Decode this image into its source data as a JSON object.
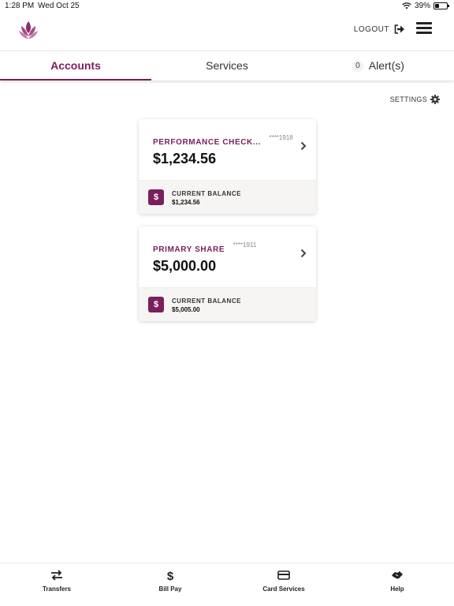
{
  "status": {
    "time": "1:28 PM",
    "date": "Wed Oct 25",
    "battery": "39%",
    "battery_level": 0.39
  },
  "header": {
    "logout_label": "LOGOUT"
  },
  "tabs": [
    {
      "label": "Accounts",
      "active": true
    },
    {
      "label": "Services",
      "active": false
    },
    {
      "label": "Alert(s)",
      "count": "0",
      "active": false
    }
  ],
  "settings_label": "SETTINGS",
  "accounts": [
    {
      "name": "PERFORMANCE CHECK...",
      "number": "****1918",
      "amount": "$1,234.56",
      "balance_label": "CURRENT BALANCE",
      "balance_value": "$1,234.56"
    },
    {
      "name": "PRIMARY SHARE",
      "number": "****1911",
      "amount": "$5,000.00",
      "balance_label": "CURRENT BALANCE",
      "balance_value": "$5,005.00"
    }
  ],
  "bottom_nav": [
    {
      "label": "Transfers",
      "icon": "transfer-arrows-icon"
    },
    {
      "label": "Bill Pay",
      "icon": "dollar-icon"
    },
    {
      "label": "Card Services",
      "icon": "credit-card-icon"
    },
    {
      "label": "Help",
      "icon": "handshake-icon"
    }
  ],
  "colors": {
    "brand": "#7b1f5c"
  }
}
